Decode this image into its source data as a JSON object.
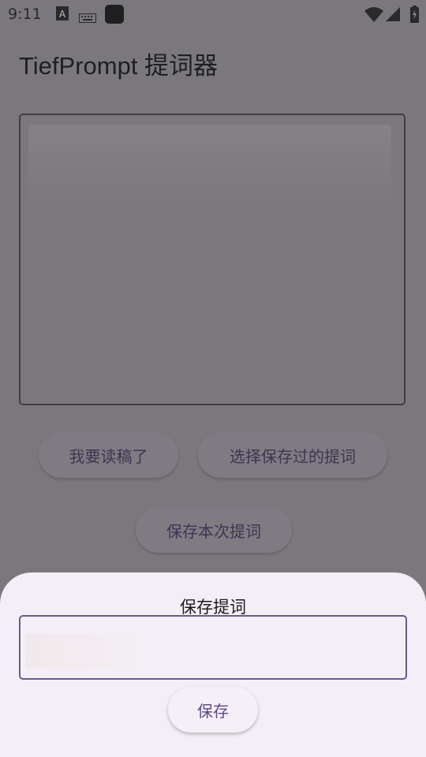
{
  "status_bar": {
    "time": "9:11",
    "icons": [
      "font-a-icon",
      "keyboard-icon",
      "app-square-icon",
      "wifi-icon",
      "signal-icon",
      "battery-charging-icon"
    ]
  },
  "app": {
    "title": "TiefPrompt 提词器"
  },
  "buttons": {
    "read": "我要读稿了",
    "choose_saved": "选择保存过的提词",
    "save_current": "保存本次提词"
  },
  "sheet": {
    "title": "保存提词",
    "save_label": "保存"
  },
  "colors": {
    "scrim_background": "#7b787d",
    "sheet_background": "#f4eff6",
    "accent": "#6a5a8e"
  }
}
